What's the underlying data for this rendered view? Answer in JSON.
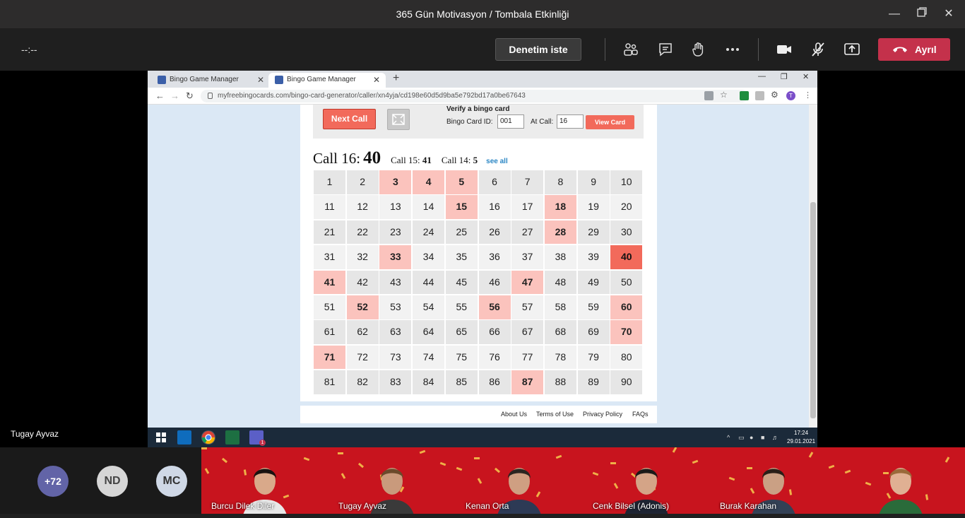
{
  "window": {
    "title": "365 Gün Motivasyon / Tombala Etkinliği"
  },
  "meeting_bar": {
    "timer": "--:--",
    "denetim_label": "Denetim iste",
    "leave_label": "Ayrıl"
  },
  "browser": {
    "tabs": [
      {
        "label": "Bingo Game Manager"
      },
      {
        "label": "Bingo Game Manager"
      }
    ],
    "url": "myfreebingocards.com/bingo-card-generator/caller/xn4yja/cd198e60d5d9ba5e792bd17a0be67643",
    "profile_initial": "T"
  },
  "bingo": {
    "next_call_label": "Next Call",
    "verify_title": "Verify a bingo card",
    "card_id_label": "Bingo Card ID:",
    "card_id_value": "001",
    "at_call_label": "At Call:",
    "at_call_value": "16",
    "view_card_label": "View Card",
    "current_call_label": "Call 16:",
    "current_call_value": "40",
    "prev_calls": [
      {
        "label": "Call 15:",
        "value": "41"
      },
      {
        "label": "Call 14:",
        "value": "5"
      }
    ],
    "see_all_label": "see all",
    "numbers": [
      1,
      2,
      3,
      4,
      5,
      6,
      7,
      8,
      9,
      10,
      11,
      12,
      13,
      14,
      15,
      16,
      17,
      18,
      19,
      20,
      21,
      22,
      23,
      24,
      25,
      26,
      27,
      28,
      29,
      30,
      31,
      32,
      33,
      34,
      35,
      36,
      37,
      38,
      39,
      40,
      41,
      42,
      43,
      44,
      45,
      46,
      47,
      48,
      49,
      50,
      51,
      52,
      53,
      54,
      55,
      56,
      57,
      58,
      59,
      60,
      61,
      62,
      63,
      64,
      65,
      66,
      67,
      68,
      69,
      70,
      71,
      72,
      73,
      74,
      75,
      76,
      77,
      78,
      79,
      80,
      81,
      82,
      83,
      84,
      85,
      86,
      87,
      88,
      89,
      90
    ],
    "called_numbers": [
      3,
      4,
      5,
      15,
      18,
      28,
      33,
      41,
      47,
      52,
      56,
      60,
      70,
      71,
      87
    ],
    "current_number": 40,
    "colors": {
      "current": "#f26a5b",
      "called": "#fbc3bd",
      "accent_button": "#f26a5b"
    }
  },
  "footer_links": [
    "About Us",
    "Terms of Use",
    "Privacy Policy",
    "FAQs"
  ],
  "taskbar": {
    "time": "17:24",
    "date": "29.01.2021",
    "teams_badge": "1"
  },
  "presenter_name": "Tugay Ayvaz",
  "participants": {
    "overflow_count": "+72",
    "avatars": [
      {
        "initials": "ND",
        "bg": "#d6d6d6"
      },
      {
        "initials": "MC",
        "bg": "#cfd8e6"
      }
    ],
    "video_tiles": [
      {
        "name": "Burcu Dilek Diler"
      },
      {
        "name": "Tugay Ayvaz"
      },
      {
        "name": "Kenan Orta"
      },
      {
        "name": "Cenk Bilsel (Adonis)"
      },
      {
        "name": "Burak Karahan"
      },
      {
        "name": ""
      }
    ]
  }
}
